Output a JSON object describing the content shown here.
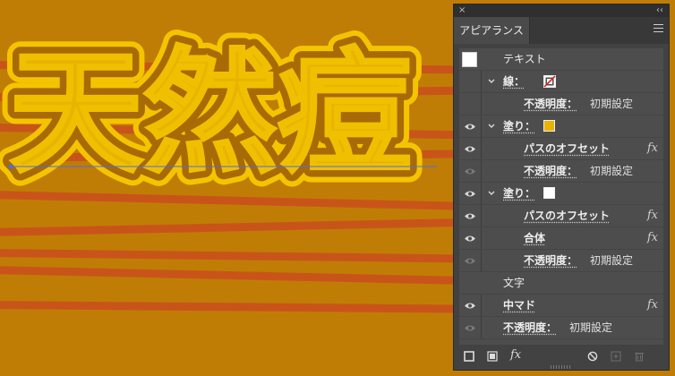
{
  "canvas": {
    "artwork_text": "天然痘",
    "colors": {
      "background": "#c07d06",
      "stripe": "#c9541a",
      "text_fill": "#e8b400",
      "outline": "#f5c400",
      "offset_dark": "#a86a05",
      "guide": "#4a6cf0"
    }
  },
  "panel": {
    "tab_label": "アピアランス",
    "rows": [
      {
        "label": "テキスト"
      },
      {
        "label": "線："
      },
      {
        "label": "不透明度：",
        "value": "初期設定"
      },
      {
        "label": "塗り："
      },
      {
        "label": "パスのオフセット",
        "fx": "fx"
      },
      {
        "label": "不透明度：",
        "value": "初期設定"
      },
      {
        "label": "塗り："
      },
      {
        "label": "パスのオフセット",
        "fx": "fx"
      },
      {
        "label": "合体",
        "fx": "fx"
      },
      {
        "label": "不透明度：",
        "value": "初期設定"
      },
      {
        "label": "文字"
      },
      {
        "label": "中マド",
        "fx": "fx"
      },
      {
        "label": "不透明度：",
        "value": "初期設定"
      }
    ],
    "footer": {
      "fx_label": "fx"
    },
    "icons": {
      "close": "×",
      "collapse": "‹‹",
      "fx": "fx"
    },
    "colors": {
      "panel_bg": "#424242",
      "list_bg": "#4d4d4d",
      "fill_swatch_yellow": "#e8b400",
      "fill_swatch_white": "#ffffff"
    }
  }
}
